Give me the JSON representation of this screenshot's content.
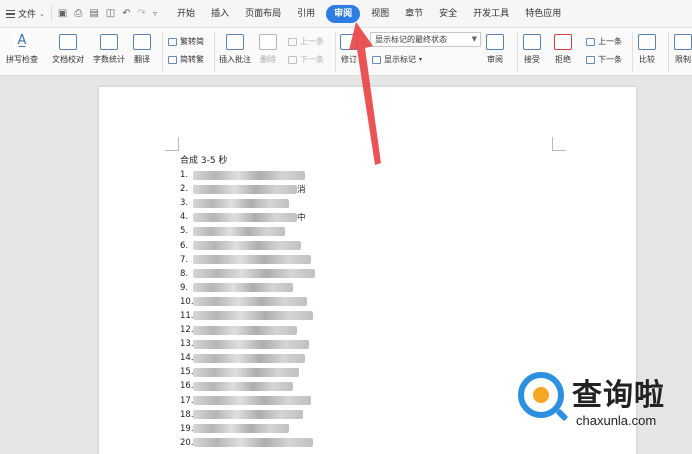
{
  "menubar": {
    "file_label": "文件",
    "tabs": [
      {
        "label": "开始",
        "active": false
      },
      {
        "label": "插入",
        "active": false
      },
      {
        "label": "页面布局",
        "active": false
      },
      {
        "label": "引用",
        "active": false
      },
      {
        "label": "审阅",
        "active": true
      },
      {
        "label": "视图",
        "active": false
      },
      {
        "label": "章节",
        "active": false
      },
      {
        "label": "安全",
        "active": false
      },
      {
        "label": "开发工具",
        "active": false
      },
      {
        "label": "特色应用",
        "active": false
      }
    ]
  },
  "ribbon": {
    "spell_check": "拼写检查",
    "doc_proof": "文档校对",
    "word_count": "字数统计",
    "translate": "翻译",
    "trad_to_simp": "繁转简",
    "simp_to_trad": "简转繁",
    "insert_comment": "插入批注",
    "delete_comment": "删除",
    "prev_comment": "上一条",
    "next_comment": "下一条",
    "track_changes": "修订",
    "markup_select_value": "显示标记的最终状态",
    "show_markup": "显示标记",
    "review_pane": "审阅",
    "accept": "接受",
    "reject": "拒绝",
    "prev_change": "上一条",
    "next_change": "下一条",
    "compare": "比较",
    "restrict": "限制"
  },
  "document": {
    "title": "合成 3-5 秒",
    "numbers": [
      "1.",
      "2.",
      "3.",
      "4.",
      "5.",
      "6.",
      "7.",
      "8.",
      "9.",
      "10.",
      "11.",
      "12.",
      "13.",
      "14.",
      "15.",
      "16.",
      "17.",
      "18.",
      "19.",
      "20."
    ],
    "line2_tail": "消",
    "line4_tail": "中"
  },
  "watermark": {
    "brand": "查询啦",
    "url": "chaxunla.com"
  },
  "colors": {
    "active_tab": "#2e7de0",
    "arrow": "#e84545",
    "brand_blue": "#2c8fe0",
    "brand_orange": "#f5a623"
  }
}
